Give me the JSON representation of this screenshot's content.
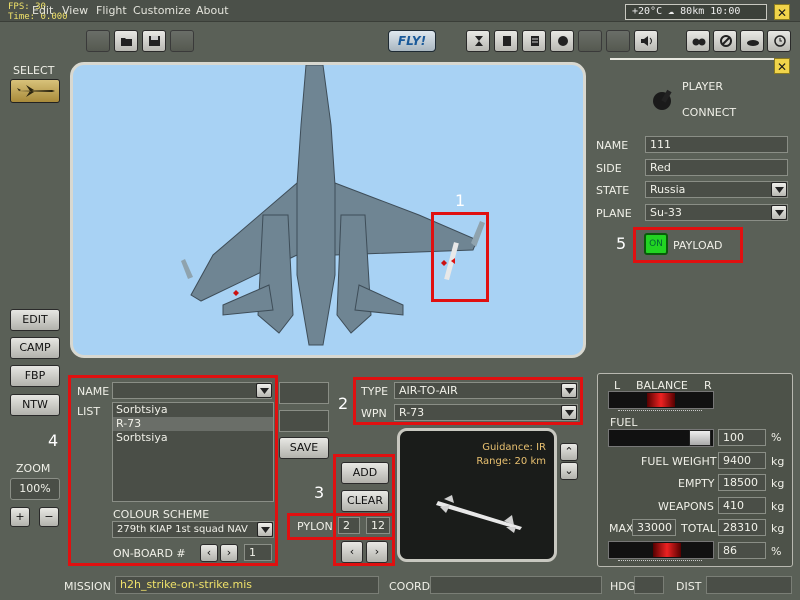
{
  "menu": {
    "items": [
      "Edit",
      "View",
      "Flight",
      "Customize",
      "About"
    ]
  },
  "fps": {
    "line1": "FPS: 30",
    "line2": "Time: 0.000"
  },
  "weather": {
    "text": "+20°C ☁ 80km 10:00"
  },
  "toolbar": {
    "fly_label": "FLY!"
  },
  "left": {
    "select_label": "SELECT",
    "edit": "EDIT",
    "camp": "CAMP",
    "fbp": "FBP",
    "ntw": "NTW",
    "zoom_label": "ZOOM",
    "zoom_value": "100%",
    "zoom_in": "+",
    "zoom_out": "−"
  },
  "player": {
    "player_label": "PLAYER",
    "connect_label": "CONNECT",
    "name_label": "NAME",
    "name_value": "111",
    "side_label": "SIDE",
    "side_value": "Red",
    "state_label": "STATE",
    "state_value": "Russia",
    "plane_label": "PLANE",
    "plane_value": "Su-33",
    "on_label": "ON",
    "payload_label": "PAYLOAD"
  },
  "annotations": [
    "1",
    "2",
    "3",
    "4",
    "5"
  ],
  "loadout": {
    "name_label": "NAME",
    "list_label": "LIST",
    "list_items": [
      "Sorbtsiya",
      "R-73",
      "Sorbtsiya"
    ],
    "selected_index": 1,
    "save_label": "SAVE",
    "colour_label": "COLOUR SCHEME",
    "colour_value": "279th KIAP 1st squad NAV",
    "onboard_label": "ON-BOARD #",
    "onboard_value": "1"
  },
  "weapon": {
    "type_label": "TYPE",
    "type_value": "AIR-TO-AIR",
    "wpn_label": "WPN",
    "wpn_value": "R-73",
    "guidance": "Guidance: IR",
    "range": "Range: 20 km",
    "add_label": "ADD",
    "clear_label": "CLEAR",
    "pylon_label": "PYLON",
    "pylon_value": "2",
    "pylon_total": "12"
  },
  "fuel": {
    "l_label": "L",
    "balance_label": "BALANCE",
    "r_label": "R",
    "fuel_label": "FUEL",
    "fuel_value": "100",
    "fuel_unit": "%",
    "fuel_weight_label": "FUEL WEIGHT",
    "fuel_weight_value": "9400",
    "fuel_weight_unit": "kg",
    "empty_label": "EMPTY",
    "empty_value": "18500",
    "empty_unit": "kg",
    "weapons_label": "WEAPONS",
    "weapons_value": "410",
    "weapons_unit": "kg",
    "max_label": "MAX",
    "max_value": "33000",
    "total_label": "TOTAL",
    "total_value": "28310",
    "total_unit": "kg",
    "cg_value": "86",
    "cg_unit": "%"
  },
  "status": {
    "mission_label": "MISSION",
    "mission_value": "h2h_strike-on-strike.mis",
    "coord_label": "COORD",
    "hdg_label": "HDG",
    "dist_label": "DIST"
  }
}
